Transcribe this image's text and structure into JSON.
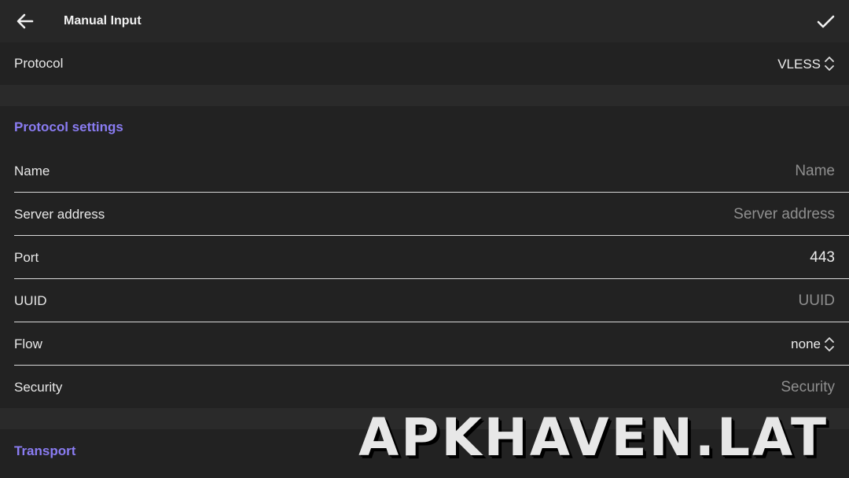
{
  "appbar": {
    "title": "Manual Input",
    "back_icon": "arrow-left-icon",
    "confirm_icon": "check-icon"
  },
  "protocol": {
    "label": "Protocol",
    "value": "VLESS"
  },
  "protocol_settings": {
    "header": "Protocol settings",
    "fields": {
      "name": {
        "label": "Name",
        "placeholder": "Name"
      },
      "server_address": {
        "label": "Server address",
        "placeholder": "Server address"
      },
      "port": {
        "label": "Port",
        "value": "443"
      },
      "uuid": {
        "label": "UUID",
        "placeholder": "UUID"
      },
      "flow": {
        "label": "Flow",
        "value": "none"
      },
      "security": {
        "label": "Security",
        "placeholder": "Security"
      }
    }
  },
  "transport": {
    "header": "Transport"
  },
  "watermark": "APKHAVEN.LAT",
  "colors": {
    "accent": "#8a7cf2",
    "background": "#212121",
    "appbar": "#272727",
    "section_gap": "#2a2a2a"
  }
}
